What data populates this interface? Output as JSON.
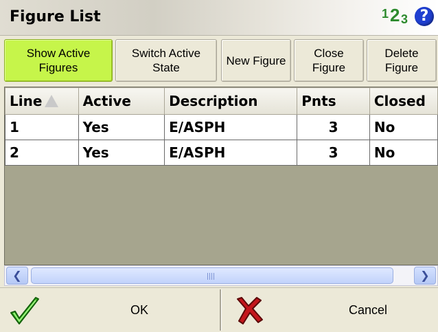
{
  "window": {
    "title": "Figure List"
  },
  "header_icons": {
    "number_format_icon": "numbers-123-icon",
    "help_icon": "?",
    "help_color": "#1f3fd1"
  },
  "toolbar": {
    "buttons": [
      {
        "label": "Show Active Figures",
        "active": true,
        "color": "#c6f54a"
      },
      {
        "label": "Switch Active State"
      },
      {
        "label": "New Figure"
      },
      {
        "label": "Close Figure"
      },
      {
        "label": "Delete Figure"
      }
    ]
  },
  "table": {
    "columns": [
      "Line",
      "Active",
      "Description",
      "Pnts",
      "Closed"
    ],
    "sort_column": "Line",
    "rows": [
      {
        "line": "1",
        "active": "Yes",
        "description": "E/ASPH",
        "pnts": "3",
        "closed": "No"
      },
      {
        "line": "2",
        "active": "Yes",
        "description": "E/ASPH",
        "pnts": "3",
        "closed": "No"
      }
    ]
  },
  "footer": {
    "ok_label": "OK",
    "cancel_label": "Cancel"
  }
}
